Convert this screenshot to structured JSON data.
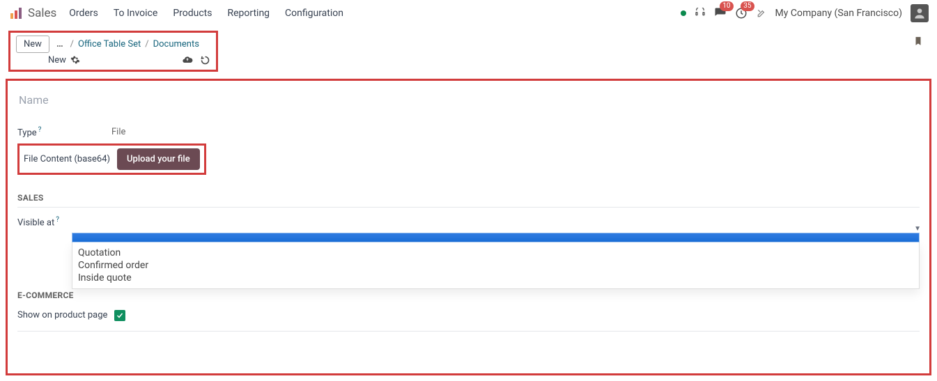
{
  "nav": {
    "app": "Sales",
    "items": [
      "Orders",
      "To Invoice",
      "Products",
      "Reporting",
      "Configuration"
    ],
    "company": "My Company (San Francisco)",
    "messages_badge": "10",
    "activities_badge": "35"
  },
  "breadcrumb": {
    "new_btn": "New",
    "ellipsis": "…",
    "parent": "Office Table Set",
    "current": "Documents",
    "sub": "New"
  },
  "form": {
    "name_placeholder": "Name",
    "type_label": "Type",
    "type_help": "?",
    "type_value": "File",
    "file_content_label": "File Content (base64)",
    "upload_label": "Upload your file"
  },
  "sections": {
    "sales": "SALES",
    "visible_label": "Visible at",
    "visible_help": "?",
    "dropdown_options": [
      "Quotation",
      "Confirmed order",
      "Inside quote"
    ],
    "ecommerce": "E-COMMERCE",
    "show_label": "Show on product page",
    "show_checked": true
  }
}
